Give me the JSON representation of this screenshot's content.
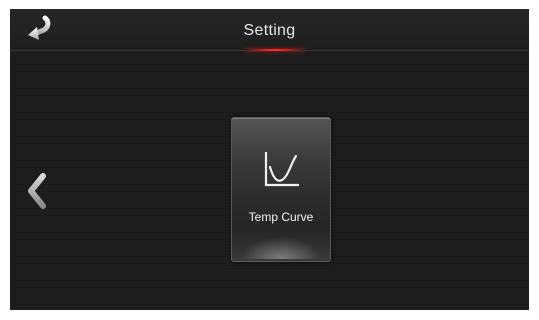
{
  "header": {
    "title": "Setting",
    "back_icon": "back-arrow-icon",
    "accent_color": "#e02020"
  },
  "main": {
    "nav_prev_icon": "chevron-left-icon",
    "tiles": [
      {
        "label": "Temp Curve",
        "icon": "temperature-curve-icon"
      }
    ]
  }
}
